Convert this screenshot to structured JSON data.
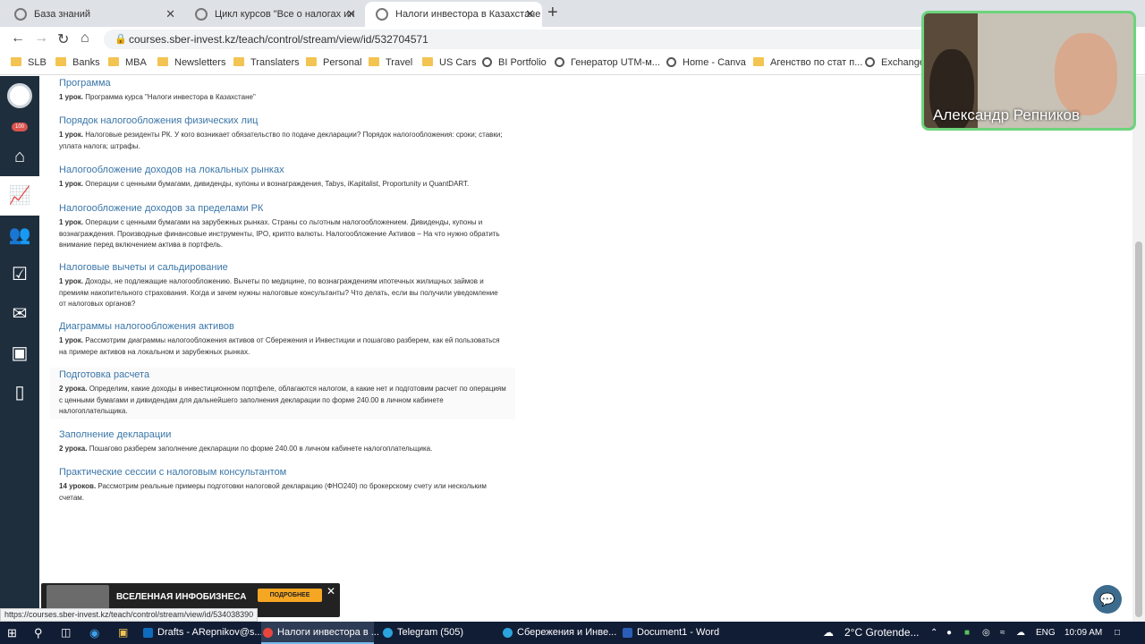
{
  "browser": {
    "tabs": [
      {
        "title": "База знаний",
        "close": "✕"
      },
      {
        "title": "Цикл курсов \"Все о налогах ин",
        "close": "✕"
      },
      {
        "title": "Налоги инвестора в Казахстане",
        "close": "✕"
      }
    ],
    "new_tab": "+",
    "url": "courses.sber-invest.kz/teach/control/stream/view/id/532704571",
    "bookmarks": [
      "SLB",
      "Banks",
      "MBA",
      "Newsletters",
      "Translaters",
      "Personal",
      "Travel",
      "US Cars",
      "BI Portfolio",
      "Генератор UTM-м...",
      "Home - Canva",
      "Агенство по стат п...",
      "Exchange"
    ]
  },
  "sidebar": {
    "badge": "100"
  },
  "lessons": [
    {
      "title": "Программа",
      "count": "1 урок.",
      "desc": "Программа курса \"Налоги инвестора в Казахстане\""
    },
    {
      "title": "Порядок налогообложения физических лиц",
      "count": "1 урок.",
      "desc": "Налоговые резиденты РК. У кого возникает обязательство по подаче декларации? Порядок налогообложения: сроки; ставки; уплата налога; штрафы."
    },
    {
      "title": "Налогообложение доходов на локальных рынках",
      "count": "1 урок.",
      "desc": "Операции с ценными бумагами, дивиденды, купоны и вознаграждения, Tabys, iKapitalist, Proportunity и QuantDART."
    },
    {
      "title": "Налогообложение доходов за пределами РК",
      "count": "1 урок.",
      "desc": "Операции с ценными бумагами на зарубежных рынках. Страны со льготным налогообложением. Дивиденды, купоны и вознаграждения. Производные финансовые инструменты, IPO, крипто валюты. Налогообложение Активов – На что нужно обратить внимание перед включением актива в портфель."
    },
    {
      "title": "Налоговые вычеты и сальдирование",
      "count": "1 урок.",
      "desc": "Доходы, не подлежащие налогообложению. Вычеты по медицине, по вознаграждениям ипотечных жилищных займов и премиям накопительного страхования. Когда и зачем нужны налоговые консультанты? Что делать, если вы получили уведомление от налоговых органов?"
    },
    {
      "title": "Диаграммы налогообложения активов",
      "count": "1 урок.",
      "desc": "Рассмотрим диаграммы налогообложения активов от Сбережения и Инвестиции и пошагово разберем, как ей пользоваться на примере активов на локальном и зарубежных рынках."
    },
    {
      "title": "Подготовка расчета",
      "count": "2 урока.",
      "desc": "Определим, какие доходы в инвестиционном портфеле, облагаются налогом, а какие нет и подготовим расчет по операциям с ценными бумагами и дивидендам для дальнейшего заполнения декларации по форме 240.00 в личном кабинете налогоплательщика."
    },
    {
      "title": "Заполнение декларации",
      "count": "2 урока.",
      "desc": "Пошагово разберем заполнение декларации по форме 240.00 в личном кабинете налогоплательщика."
    },
    {
      "title": "Практические сессии с налоговым консультантом",
      "count": "14 уроков.",
      "desc": "Рассмотрим реальные примеры подготовки налоговой декларацию (ФНО240) по брокерскому счету или нескольким счетам."
    }
  ],
  "video": {
    "name": "Александр Репников"
  },
  "banner": {
    "title": "ВСЕЛЕННАЯ ИНФОБИЗНЕСА",
    "button": "ПОДРОБНЕЕ",
    "close": "✕"
  },
  "status_url": "https://courses.sber-invest.kz/teach/control/stream/view/id/534038390",
  "taskbar": {
    "apps": [
      "Drafts - ARepnikov@s...",
      "Налоги инвестора в ...",
      "Telegram (505)",
      "Сбережения и Инве...",
      "Document1 - Word"
    ],
    "weather": "2°C  Grotende...",
    "lang": "ENG",
    "time": "10:09 AM"
  }
}
